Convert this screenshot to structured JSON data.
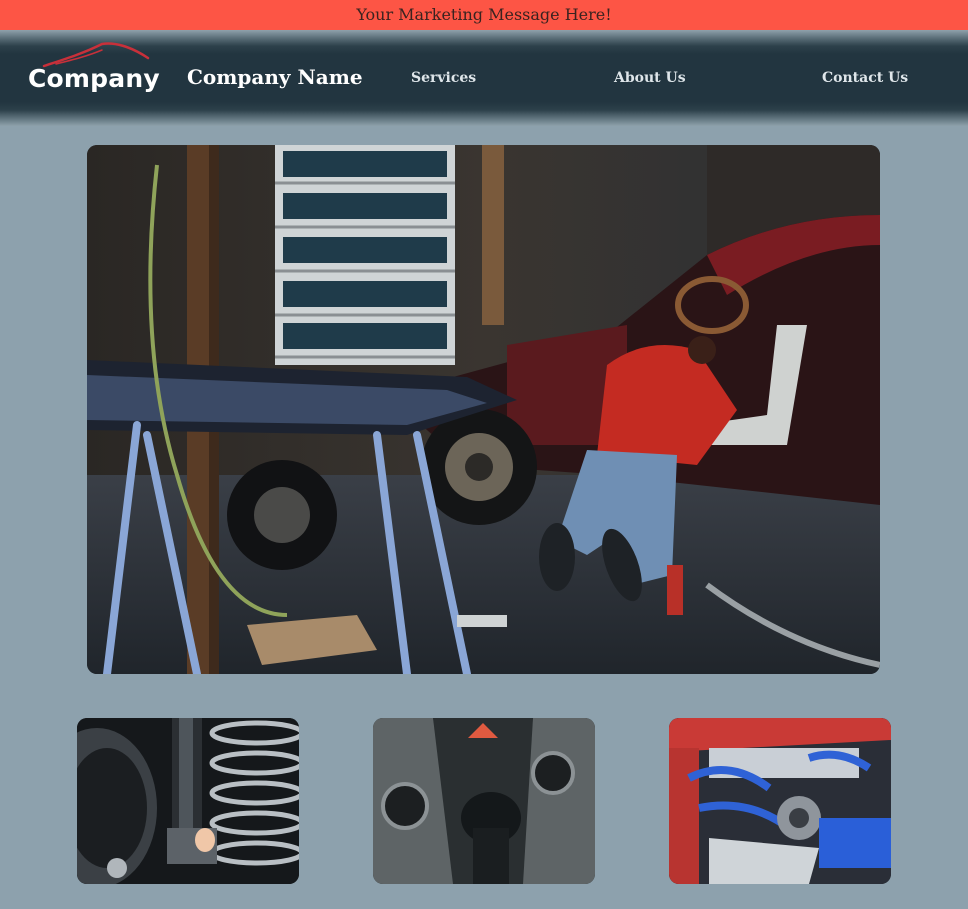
{
  "promo": {
    "message": "Your Marketing Message Here!"
  },
  "header": {
    "logo_text": "Company",
    "brand_name": "Company Name",
    "nav": [
      {
        "label": "Services"
      },
      {
        "label": "About Us"
      },
      {
        "label": "Contact Us"
      }
    ]
  },
  "colors": {
    "promo_bar": "#fd5545",
    "nav_background": "#223540",
    "page_background": "#8da1ad",
    "logo_accent": "#c8303a"
  }
}
